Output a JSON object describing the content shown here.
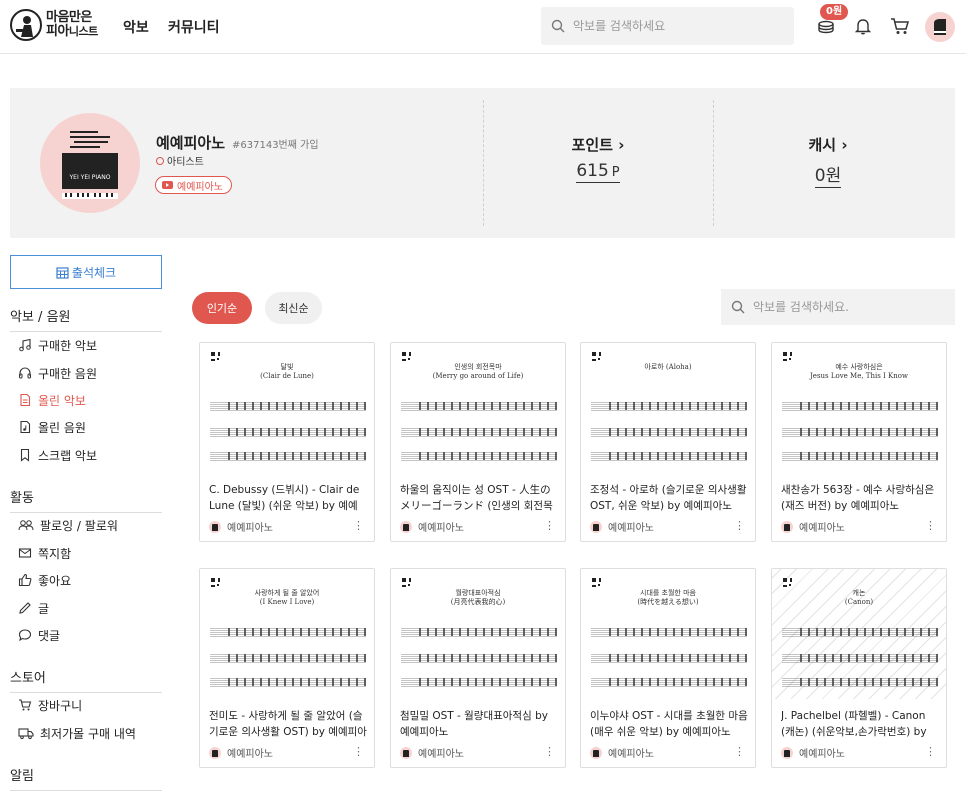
{
  "header": {
    "logo_line1": "마음만은",
    "logo_line2_big": "피아",
    "logo_line2_small": "니스트",
    "nav": [
      "악보",
      "커뮤니티"
    ],
    "search_placeholder": "악보를 검색하세요",
    "coin_badge": "0원"
  },
  "profile": {
    "name": "예예피아노",
    "join_info": "#637143번째 가입",
    "role": "아티스트",
    "youtube_label": "예예피아노",
    "avatar_text": "YEI YEI PIANO",
    "points_label": "포인트",
    "points_value": "615",
    "points_unit": "P",
    "cash_label": "캐시",
    "cash_value": "0원"
  },
  "sidebar": {
    "checkin": "출석체크",
    "sections": [
      {
        "title": "악보 / 음원",
        "items": [
          "구매한 악보",
          "구매한 음원",
          "올린 악보",
          "올린 음원",
          "스크랩 악보"
        ]
      },
      {
        "title": "활동",
        "items": [
          "팔로잉 / 팔로워",
          "쪽지함",
          "좋아요",
          "글",
          "댓글"
        ]
      },
      {
        "title": "스토어",
        "items": [
          "장바구니",
          "최저가몰 구매 내역"
        ]
      },
      {
        "title": "알림",
        "items": []
      }
    ],
    "active_item": "올린 악보"
  },
  "list": {
    "sort_popular": "인기순",
    "sort_recent": "최신순",
    "search_placeholder": "악보를 검색하세요.",
    "cards": [
      {
        "title": "C. Debussy (드뷔시) - Clair de Lune (달빛) (쉬운 악보) by 예예피아노",
        "author": "예예피아노",
        "score_title": "달빛\n(Clair de Lune)"
      },
      {
        "title": "하울의 움직이는 성 OST - 人生のメリーゴーランド (인생의 회전목마)",
        "author": "예예피아노",
        "score_title": "인생의 회전목마\n(Merry go around of Life)"
      },
      {
        "title": "조정석 - 아로하 (슬기로운 의사생활 OST, 쉬운 악보) by 예예피아노",
        "author": "예예피아노",
        "score_title": "아로하 (Aloha)"
      },
      {
        "title": "새찬송가 563장 - 예수 사랑하심은 (재즈 버전) by 예예피아노",
        "author": "예예피아노",
        "score_title": "예수 사랑하심은\nJesus Love Me, This I Know"
      },
      {
        "title": "전미도 - 사랑하게 될 줄 알았어 (슬기로운 의사생활 OST) by 예예피아노",
        "author": "예예피아노",
        "score_title": "사랑하게 될 줄 알았어\n(I Knew I Love)"
      },
      {
        "title": "첨밀밀 OST - 월량대표아적심 by 예예피아노",
        "author": "예예피아노",
        "score_title": "월량대표아적심\n(月亮代表我的心)"
      },
      {
        "title": "이누야샤 OST - 시대를 초월한 마음 (매우 쉬운 악보) by 예예피아노",
        "author": "예예피아노",
        "score_title": "시대를 초월한 마음\n(時代を越える想い)"
      },
      {
        "title": "J. Pachelbel (파헬벨) - Canon (캐논) (쉬운악보,손가락번호) by 예예피아노",
        "author": "예예피아노",
        "score_title": "캐논\n(Canon)"
      }
    ]
  },
  "colors": {
    "accent": "#e0574f",
    "checkin_blue": "#3b7fd0",
    "panel_bg": "#f2f2f2",
    "avatar_bg": "#f6d3d0"
  }
}
